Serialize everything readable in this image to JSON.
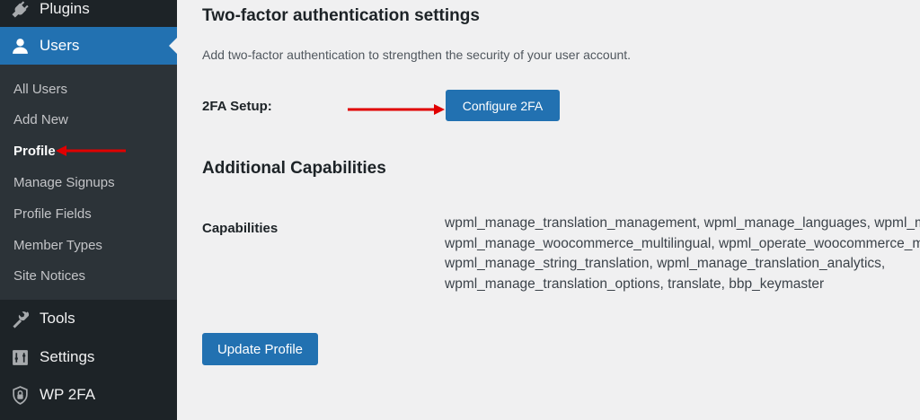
{
  "sidebar": {
    "items": [
      {
        "label": "Plugins",
        "icon": "plugin-icon"
      },
      {
        "label": "Users",
        "icon": "user-icon"
      },
      {
        "label": "Tools",
        "icon": "wrench-icon"
      },
      {
        "label": "Settings",
        "icon": "settings-sliders-icon"
      },
      {
        "label": "WP 2FA",
        "icon": "shield-lock-icon"
      }
    ],
    "submenu": [
      {
        "label": "All Users"
      },
      {
        "label": "Add New"
      },
      {
        "label": "Profile"
      },
      {
        "label": "Manage Signups"
      },
      {
        "label": "Profile Fields"
      },
      {
        "label": "Member Types"
      },
      {
        "label": "Site Notices"
      }
    ]
  },
  "twofa": {
    "title": "Two-factor authentication settings",
    "description": "Add two-factor authentication to strengthen the security of your user account.",
    "setup_label": "2FA Setup:",
    "configure_button": "Configure 2FA"
  },
  "capabilities": {
    "title": "Additional Capabilities",
    "label": "Capabilities",
    "lines": [
      "wpml_manage_translation_management, wpml_manage_languages, wpml_manage_theme_and_plugin_localization,",
      "wpml_manage_woocommerce_multilingual, wpml_operate_woocommerce_multilingual,",
      "wpml_manage_string_translation, wpml_manage_translation_analytics,",
      "wpml_manage_translation_options, translate, bbp_keymaster"
    ]
  },
  "update_button": "Update Profile",
  "colors": {
    "sidebar_bg": "#1d2327",
    "submenu_bg": "#2c3338",
    "accent": "#2271b1",
    "annotation_arrow": "#e00000"
  }
}
